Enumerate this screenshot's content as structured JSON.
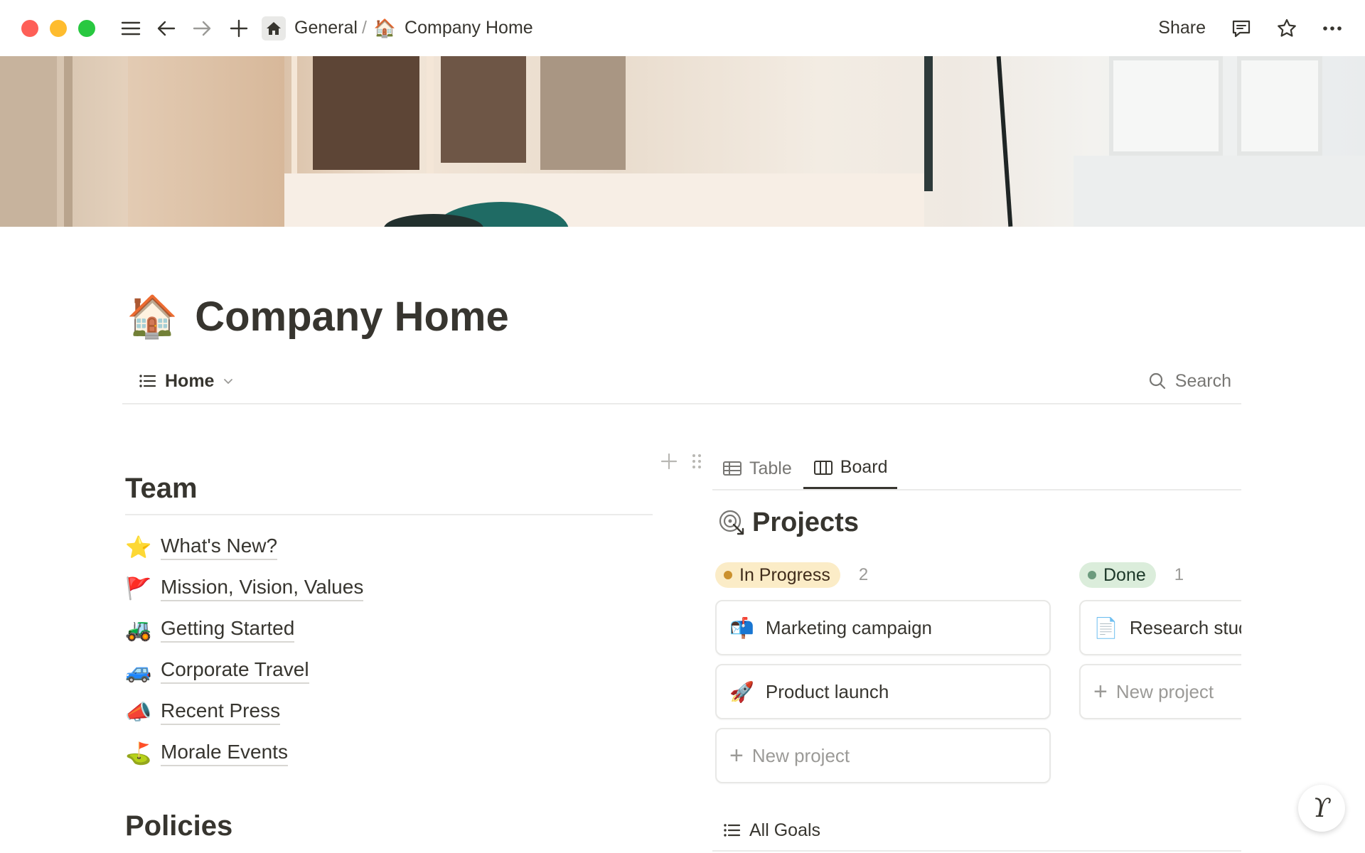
{
  "titlebar": {
    "breadcrumb": [
      {
        "label": "General",
        "icon": "house-icon"
      },
      {
        "label": "Company Home",
        "emoji": "🏠"
      }
    ],
    "separator": "/",
    "share_label": "Share"
  },
  "page": {
    "emoji": "🏠",
    "title": "Company Home"
  },
  "viewbar": {
    "current_view": "Home",
    "search_label": "Search"
  },
  "team": {
    "heading": "Team",
    "links": [
      {
        "emoji": "⭐",
        "label": "What's New?"
      },
      {
        "emoji": "🚩",
        "label": "Mission, Vision, Values"
      },
      {
        "emoji": "🚜",
        "label": "Getting Started"
      },
      {
        "emoji": "🚙",
        "label": "Corporate Travel"
      },
      {
        "emoji": "📣",
        "label": "Recent Press"
      },
      {
        "emoji": "⛳",
        "label": "Morale Events"
      }
    ]
  },
  "policies": {
    "heading": "Policies"
  },
  "database": {
    "tabs": [
      {
        "label": "Table",
        "active": false
      },
      {
        "label": "Board",
        "active": true
      }
    ],
    "title": "Projects",
    "columns": [
      {
        "status": "In Progress",
        "count": "2",
        "cards": [
          {
            "emoji": "📬",
            "title": "Marketing campaign"
          },
          {
            "emoji": "🚀",
            "title": "Product launch"
          }
        ],
        "new_label": "New project"
      },
      {
        "status": "Done",
        "count": "1",
        "cards": [
          {
            "emoji": "📄",
            "title": "Research study"
          }
        ],
        "new_label": "New project"
      }
    ],
    "linked_view": "All Goals"
  },
  "colors": {
    "text": "#37352f",
    "muted": "#787774",
    "in_progress_bg": "#fbecc7",
    "done_bg": "#dbeddb"
  }
}
